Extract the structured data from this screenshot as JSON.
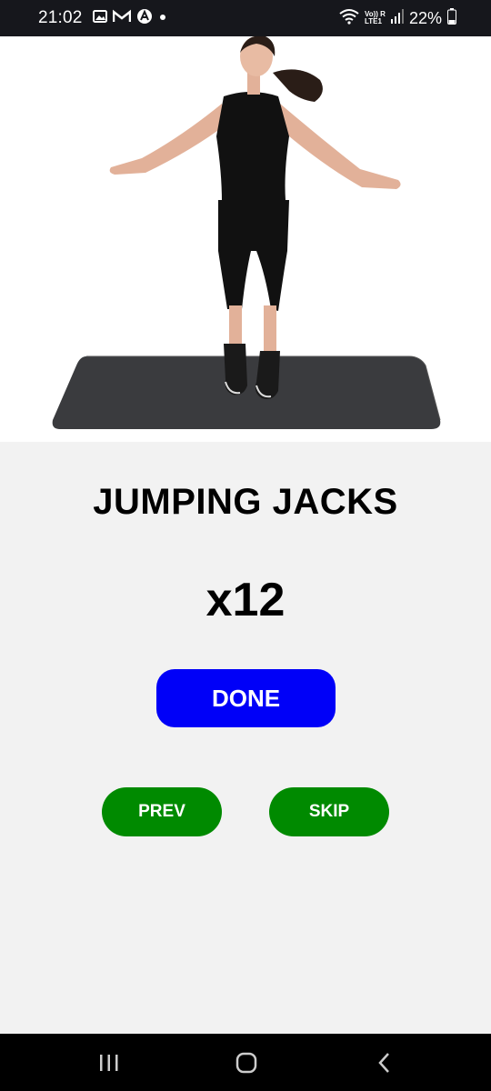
{
  "status_bar": {
    "time": "21:02",
    "battery": "22%",
    "left_icons": [
      "gallery-icon",
      "gmail-icon",
      "app-icon",
      "dot-icon"
    ],
    "right_icons": [
      "wifi-icon",
      "volte-lte-icon",
      "signal-icon",
      "battery-icon"
    ],
    "lte_line1": "Vo)) R",
    "lte_line2": "LTE1"
  },
  "exercise": {
    "title": "JUMPING JACKS",
    "reps": "x12"
  },
  "buttons": {
    "done": "DONE",
    "prev": "PREV",
    "skip": "SKIP"
  },
  "colors": {
    "done_bg": "#0000f8",
    "nav_bg": "#008a00",
    "page_bg": "#f2f2f2"
  },
  "system_nav": {
    "icons": [
      "recents-icon",
      "home-icon",
      "back-icon"
    ]
  }
}
